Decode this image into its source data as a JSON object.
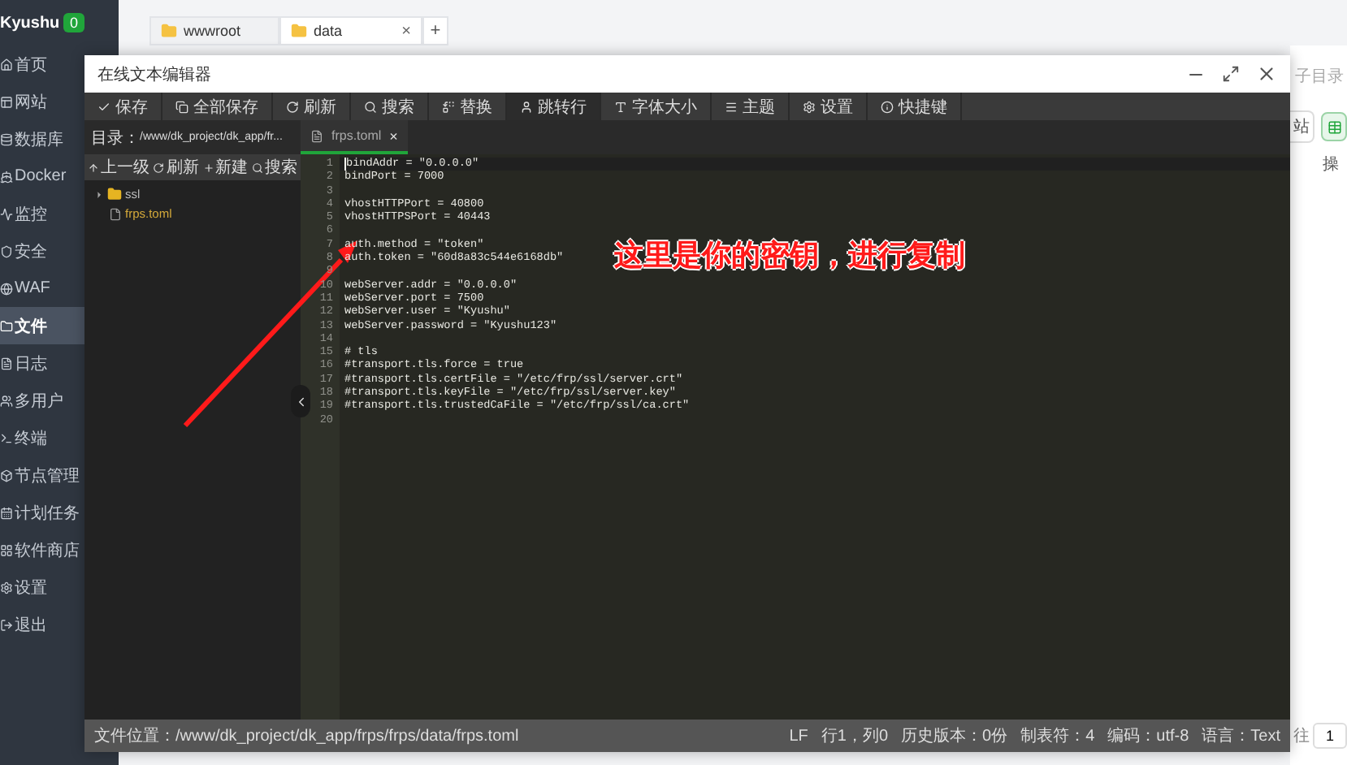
{
  "sidebar": {
    "brand": "Kyushu",
    "badge": "0",
    "items": [
      {
        "label": "首页",
        "selected": false
      },
      {
        "label": "网站",
        "selected": false
      },
      {
        "label": "数据库",
        "selected": false
      },
      {
        "label": "Docker",
        "selected": false
      },
      {
        "label": "监控",
        "selected": false
      },
      {
        "label": "安全",
        "selected": false
      },
      {
        "label": "WAF",
        "selected": false
      },
      {
        "label": "文件",
        "selected": true
      },
      {
        "label": "日志",
        "selected": false
      },
      {
        "label": "多用户",
        "selected": false
      },
      {
        "label": "终端",
        "selected": false
      },
      {
        "label": "节点管理",
        "selected": false
      },
      {
        "label": "计划任务",
        "selected": false
      },
      {
        "label": "软件商店",
        "selected": false
      },
      {
        "label": "设置",
        "selected": false
      },
      {
        "label": "退出",
        "selected": false
      }
    ]
  },
  "file_tabs": [
    {
      "label": "wwwroot",
      "selected": false
    },
    {
      "label": "data",
      "selected": true,
      "close": "×"
    }
  ],
  "add_tab": "+",
  "page_fragments": {
    "search_hint": "子目录",
    "button": "站",
    "column": "操",
    "pager_label": "往",
    "page": "1"
  },
  "editor": {
    "title": "在线文本编辑器",
    "toolbar": [
      {
        "label": "保存",
        "selected": false
      },
      {
        "label": "全部保存",
        "selected": false
      },
      {
        "label": "刷新",
        "selected": false
      },
      {
        "label": "搜索",
        "selected": false
      },
      {
        "label": "替换",
        "selected": false
      },
      {
        "label": "跳转行",
        "selected": true
      },
      {
        "label": "字体大小",
        "selected": false
      },
      {
        "label": "主题",
        "selected": false
      },
      {
        "label": "设置",
        "selected": false
      },
      {
        "label": "快捷键",
        "selected": false
      }
    ],
    "directory": {
      "label": "目录：",
      "path": "/www/dk_project/dk_app/fr..."
    },
    "dir_actions": [
      "上一级",
      "刷新",
      "新建",
      "搜索"
    ],
    "tree": [
      {
        "name": "ssl",
        "kind": "folder",
        "expanded": false,
        "selected": false
      },
      {
        "name": "frps.toml",
        "kind": "file",
        "selected": true
      }
    ],
    "tab": {
      "label": "frps.toml",
      "close": "×"
    },
    "lines": [
      {
        "number": "1",
        "text": "bindAddr = \"0.0.0.0\"",
        "active": true
      },
      {
        "number": "2",
        "text": "bindPort = 7000",
        "active": false
      },
      {
        "number": "3",
        "active": false
      },
      {
        "number": "4",
        "text": "vhostHTTPPort = 40800",
        "active": false
      },
      {
        "number": "5",
        "text": "vhostHTTPSPort = 40443",
        "active": false
      },
      {
        "number": "6",
        "active": false
      },
      {
        "number": "7",
        "text": "auth.method = \"token\"",
        "active": false
      },
      {
        "number": "8",
        "text": "auth.token = \"60d8a83c544e6168db\"",
        "active": false
      },
      {
        "number": "9",
        "active": false
      },
      {
        "number": "10",
        "text": "webServer.addr = \"0.0.0.0\"",
        "active": false
      },
      {
        "number": "11",
        "text": "webServer.port = 7500",
        "active": false
      },
      {
        "number": "12",
        "text": "webServer.user = \"Kyushu\"",
        "active": false
      },
      {
        "number": "13",
        "text": "webServer.password = \"Kyushu123\"",
        "active": false
      },
      {
        "number": "14",
        "active": false
      },
      {
        "number": "15",
        "text": "# tls",
        "active": false
      },
      {
        "number": "16",
        "text": "#transport.tls.force = true",
        "active": false
      },
      {
        "number": "17",
        "text": "#transport.tls.certFile = \"/etc/frp/ssl/server.crt\"",
        "active": false
      },
      {
        "number": "18",
        "text": "#transport.tls.keyFile = \"/etc/frp/ssl/server.key\"",
        "active": false
      },
      {
        "number": "19",
        "text": "#transport.tls.trustedCaFile = \"/etc/frp/ssl/ca.crt\"",
        "active": false
      },
      {
        "number": "20",
        "active": false
      }
    ],
    "status": {
      "path": "文件位置：/www/dk_project/dk_app/frps/frps/data/frps.toml",
      "items": [
        "LF",
        "行1，列0",
        "历史版本：0份",
        "制表符：4",
        "编码：utf-8",
        "语言：Text"
      ]
    }
  },
  "annotation": {
    "text": "这里是你的密钥，进行复制"
  }
}
